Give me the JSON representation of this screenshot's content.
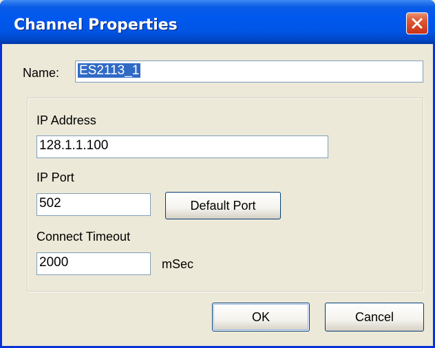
{
  "dialog": {
    "title": "Channel Properties",
    "close_icon": "close-icon"
  },
  "name_field": {
    "label": "Name:",
    "value": "ES2113_1"
  },
  "connection": {
    "ip_address_label": "IP Address",
    "ip_address_value": "128.1.1.100",
    "ip_port_label": "IP Port",
    "ip_port_value": "502",
    "default_port_label": "Default Port",
    "timeout_label": "Connect Timeout",
    "timeout_value": "2000",
    "timeout_unit": "mSec"
  },
  "buttons": {
    "ok": "OK",
    "cancel": "Cancel"
  },
  "colors": {
    "titlebar": "#0058ee",
    "dialog_bg": "#ece9d8",
    "close_button": "#de5a33",
    "selection": "#316ac5"
  }
}
